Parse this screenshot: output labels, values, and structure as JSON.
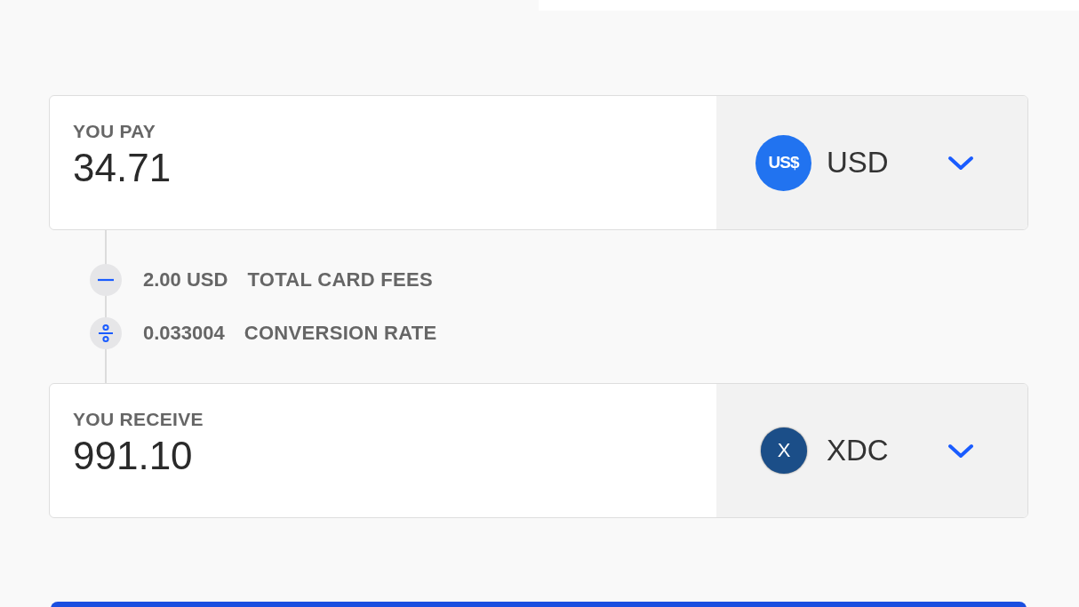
{
  "pay": {
    "label": "YOU PAY",
    "amount": "34.71",
    "currency": {
      "code": "USD",
      "badge": "US$",
      "kind": "usd"
    }
  },
  "fees": [
    {
      "kind": "minus",
      "value": "2.00 USD",
      "label": "TOTAL CARD FEES"
    },
    {
      "kind": "divide",
      "value": "0.033004",
      "label": "CONVERSION RATE"
    }
  ],
  "receive": {
    "label": "YOU RECEIVE",
    "amount": "991.10",
    "currency": {
      "code": "XDC",
      "badge": "X",
      "kind": "xdc"
    }
  }
}
